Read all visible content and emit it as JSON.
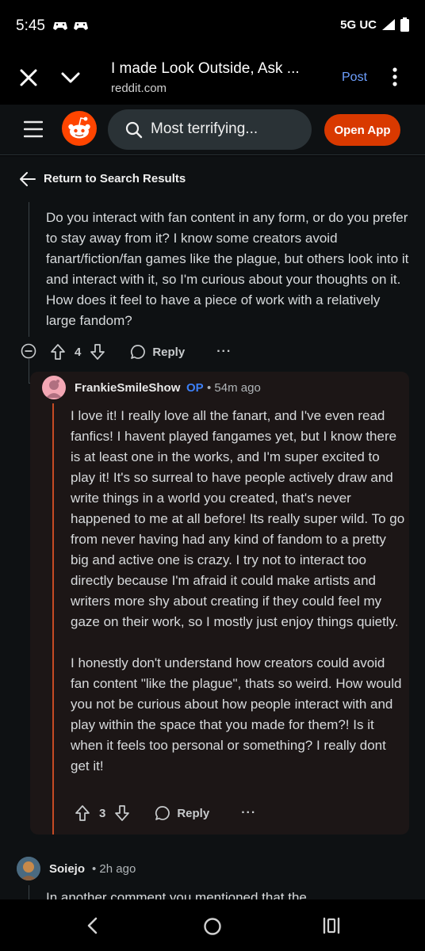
{
  "status_bar": {
    "time": "5:45",
    "network": "5G UC"
  },
  "browser": {
    "title": "I made Look Outside, Ask ...",
    "url": "reddit.com",
    "post_label": "Post"
  },
  "header": {
    "search_text": "Most terrifying...",
    "open_app_label": "Open App"
  },
  "nav": {
    "return_label": "Return to Search Results"
  },
  "parent_comment": {
    "body": "Do you interact with fan content in any form, or do you prefer to stay away from it? I know some creators avoid fanart/fiction/fan games like the plague, but others look into it and interact with it, so I'm curious about your thoughts on it. How does it feel to have a piece of work with a relatively large fandom?",
    "votes": "4",
    "reply_label": "Reply",
    "more_label": "···"
  },
  "reply_comment": {
    "author": "FrankieSmileShow",
    "badge": "OP",
    "time": "• 54m ago",
    "paragraphs": [
      "I love it! I really love all the fanart, and I've even read fanfics! I havent played fangames yet, but I know there is at least one in the works, and I'm super excited to play it! It's so surreal to have people actively draw and write things in a world you created, that's never happened to me at all before! Its really super wild. To go from never having had any kind of fandom to a pretty big and active one is crazy. I try not to interact too directly because I'm afraid it could make artists and writers more shy about creating if they could feel my gaze on their work, so I mostly just enjoy things quietly.",
      "I honestly don't understand how creators could avoid fan content \"like the plague\", thats so weird. How would you not be curious about how people interact with and play within the space that you made for them?! Is it when it feels too personal or something? I really dont get it!"
    ],
    "votes": "3",
    "reply_label": "Reply",
    "more_label": "···"
  },
  "next_comment": {
    "author": "Soiejo",
    "time": "• 2h ago",
    "body": "In another comment you mentioned that the"
  },
  "colors": {
    "background": "#0e1113",
    "accent_orange": "#d93900",
    "op_badge": "#3d7ff5",
    "post_link": "#6ea0ff",
    "reply_card": "#1c1616",
    "op_thread_line": "#c44a24"
  }
}
